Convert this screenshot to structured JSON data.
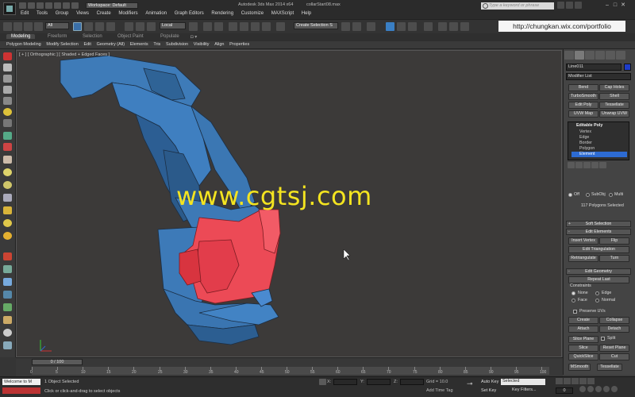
{
  "window": {
    "workspace": "Workspace: Default",
    "app_title": "Autodesk 3ds Max  2014 x64",
    "file_name": "collarStart08.max",
    "search_placeholder": "Type a keyword or phrase"
  },
  "menu": [
    "Edit",
    "Tools",
    "Group",
    "Views",
    "Create",
    "Modifiers",
    "Animation",
    "Graph Editors",
    "Rendering",
    "Customize",
    "MAXScript",
    "Help"
  ],
  "toolbar": {
    "filter_value": "All",
    "coord_system": "Local",
    "named_selection": "Create Selection S",
    "url_banner": "http://chungkan.wix.com/portfolio"
  },
  "ribbon": {
    "tabs": [
      "Modeling",
      "Freeform",
      "Selection",
      "Object Paint",
      "Populate"
    ],
    "subtabs": [
      "Polygon Modeling",
      "Modify Selection",
      "Edit",
      "Geometry (All)",
      "Elements",
      "Tris",
      "Subdivision",
      "Visibility",
      "Align",
      "Properties"
    ]
  },
  "viewport": {
    "label": "[ + ] [ Orthographic ] [ Shaded + Edged Faces ]",
    "watermark": "www.cgtsj.com",
    "frame_counter": "0 / 100"
  },
  "command_panel": {
    "object_name": "Line011",
    "object_color": "#1e3cc8",
    "modifier_list": "Modifier List",
    "modifier_buttons": [
      "Bend",
      "Cap Holes",
      "TurboSmooth",
      "Shell",
      "Edit Poly",
      "Tessellate",
      "UVW Map",
      "Unwrap UVW"
    ],
    "stack": {
      "head": "Editable Poly",
      "items": [
        "Vertex",
        "Edge",
        "Border",
        "Polygon",
        "Element"
      ],
      "selected": "Element"
    },
    "selection": {
      "off": "Off",
      "subobj": "SubObj",
      "multi": "Multi",
      "status": "117 Polygons Selected"
    },
    "soft_selection": "Soft Selection",
    "edit_elements": {
      "title": "Edit Elements",
      "insert_vertex": "Insert Vertex",
      "flip": "Flip",
      "edit_triangulation": "Edit Triangulation",
      "retriangulate": "Retriangulate",
      "turn": "Turn"
    },
    "edit_geometry": {
      "title": "Edit Geometry",
      "repeat_last": "Repeat Last",
      "constraints": "Constraints",
      "none": "None",
      "edge": "Edge",
      "face": "Face",
      "normal": "Normal",
      "preserve_uvs": "Preserve UVs",
      "create": "Create",
      "collapse": "Collapse",
      "attach": "Attach",
      "detach": "Detach",
      "slice_plane": "Slice Plane",
      "split": "Split",
      "slice": "Slice",
      "reset_plane": "Reset Plane",
      "quickslice": "QuickSlice",
      "cut": "Cut",
      "msmooth": "MSmooth",
      "tessellate": "Tessellate"
    }
  },
  "timeline": {
    "ticks": [
      "0",
      "5",
      "10",
      "15",
      "20",
      "25",
      "30",
      "35",
      "40",
      "45",
      "50",
      "55",
      "60",
      "65",
      "70",
      "75",
      "80",
      "85",
      "90",
      "95",
      "100"
    ]
  },
  "status": {
    "maxscript": "Welcome to M",
    "selected": "1 Object Selected",
    "prompt": "Click or click-and-drag to select objects",
    "x": "X:",
    "y": "Y:",
    "z": "Z:",
    "grid": "Grid = 10.0",
    "add_time_tag": "Add Time Tag",
    "auto_key": "Auto Key",
    "set_key": "Set Key",
    "selected_dropdown": "Selected",
    "key_filters": "Key Filters...",
    "frame": "0"
  }
}
